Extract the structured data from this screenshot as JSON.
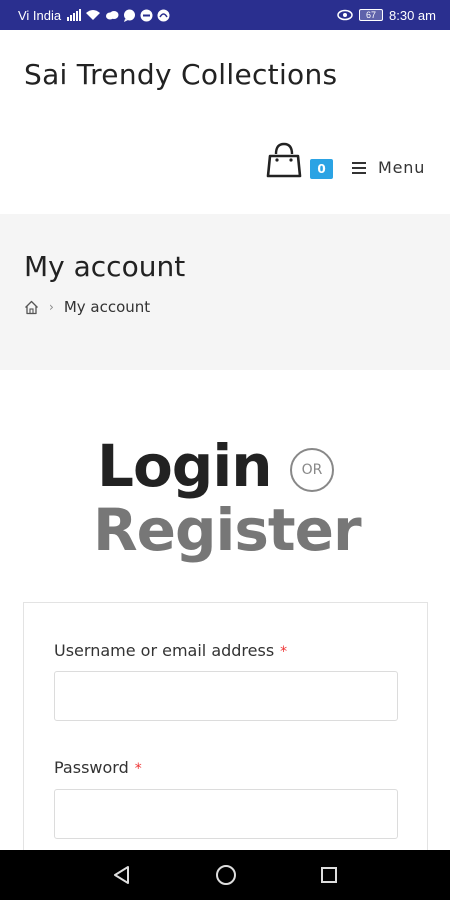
{
  "status_bar": {
    "carrier": "Vi India",
    "battery": "67",
    "time": "8:30 am"
  },
  "header": {
    "site_title": "Sai Trendy Collections",
    "cart_count": "0",
    "menu_label": "Menu"
  },
  "page_header": {
    "title": "My account",
    "breadcrumb_current": "My account"
  },
  "heading": {
    "login": "Login",
    "or": "OR",
    "register": "Register"
  },
  "form": {
    "username_label": "Username or email address",
    "password_label": "Password",
    "required_mark": "*",
    "username_value": "",
    "password_value": ""
  },
  "colors": {
    "status_bar": "#2a2f8f",
    "cart_badge": "#2ba3e4",
    "required": "#ee3333"
  }
}
